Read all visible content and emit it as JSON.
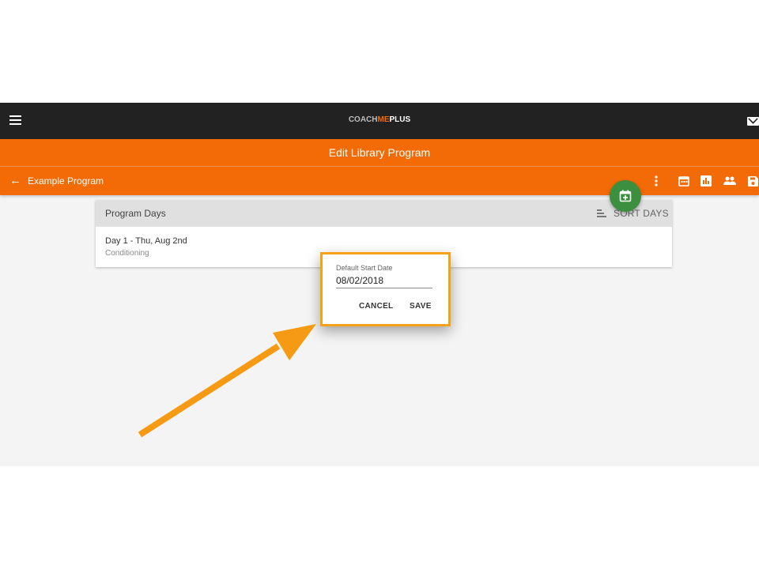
{
  "topbar": {
    "logo_coach": "COACH",
    "logo_me": "ME",
    "logo_plus": "PLUS"
  },
  "header": {
    "title": "Edit Library Program"
  },
  "program": {
    "back_label": "Example Program"
  },
  "toolbar": {
    "icons": [
      "more-vert-icon",
      "calendar-icon",
      "stats-icon",
      "people-icon",
      "save-icon"
    ]
  },
  "card": {
    "title": "Program Days",
    "sort_label": "SORT DAYS",
    "days": [
      {
        "title": "Day 1 - Thu, Aug 2nd",
        "subtitle": "Conditioning"
      }
    ]
  },
  "dialog": {
    "field_label": "Default Start Date",
    "date_value": "08/02/2018",
    "cancel_label": "CANCEL",
    "save_label": "SAVE"
  },
  "colors": {
    "brand_orange": "#f26b06",
    "topbar": "#222222",
    "fab_green": "#3c8f3e",
    "highlight": "#f6a11a"
  }
}
